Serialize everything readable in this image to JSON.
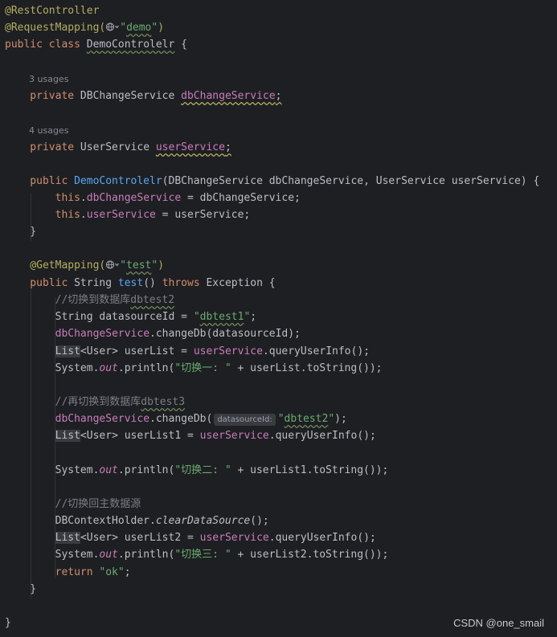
{
  "editor": {
    "lines": [
      [
        {
          "t": "@RestController",
          "c": "ann"
        }
      ],
      [
        {
          "t": "@RequestMapping(",
          "c": "ann"
        },
        {
          "icon": "web-globe-icon"
        },
        {
          "t": "\"",
          "c": "str"
        },
        {
          "t": "demo",
          "c": "str wavy"
        },
        {
          "t": "\"",
          "c": "str"
        },
        {
          "t": ")",
          "c": "ann"
        }
      ],
      [
        {
          "t": "public class ",
          "c": "kw"
        },
        {
          "t": "DemoControlelr",
          "c": "wavy"
        },
        {
          "t": " {",
          "c": ""
        }
      ],
      [],
      [
        {
          "t": "3 usages",
          "c": "usage"
        }
      ],
      [
        {
          "t": "    private ",
          "c": "kw"
        },
        {
          "t": "DBChangeService ",
          "c": ""
        },
        {
          "t": "dbChangeService",
          "c": "fld wavy-warn"
        },
        {
          "t": ";",
          "c": "wavy-warn"
        }
      ],
      [],
      [
        {
          "t": "4 usages",
          "c": "usage"
        }
      ],
      [
        {
          "t": "    private ",
          "c": "kw"
        },
        {
          "t": "UserService ",
          "c": ""
        },
        {
          "t": "userService",
          "c": "fld wavy-warn"
        },
        {
          "t": ";",
          "c": "wavy-warn"
        }
      ],
      [],
      [
        {
          "t": "    public ",
          "c": "kw"
        },
        {
          "t": "DemoControlelr",
          "c": "fn"
        },
        {
          "t": "(DBChangeService dbChangeService, UserService userService) {",
          "c": ""
        }
      ],
      [
        {
          "t": "        this",
          "c": "kw"
        },
        {
          "t": ".",
          "c": ""
        },
        {
          "t": "dbChangeService",
          "c": "fld"
        },
        {
          "t": " = dbChangeService;",
          "c": ""
        }
      ],
      [
        {
          "t": "        this",
          "c": "kw"
        },
        {
          "t": ".",
          "c": ""
        },
        {
          "t": "userService",
          "c": "fld"
        },
        {
          "t": " = userService;",
          "c": ""
        }
      ],
      [
        {
          "t": "    }",
          "c": ""
        }
      ],
      [],
      [
        {
          "t": "    @GetMapping(",
          "c": "ann"
        },
        {
          "icon": "web-globe-icon"
        },
        {
          "t": "\"",
          "c": "str"
        },
        {
          "t": "test",
          "c": "str wavy"
        },
        {
          "t": "\"",
          "c": "str"
        },
        {
          "t": ")",
          "c": "ann"
        }
      ],
      [
        {
          "t": "    public ",
          "c": "kw"
        },
        {
          "t": "String ",
          "c": ""
        },
        {
          "t": "test",
          "c": "fn"
        },
        {
          "t": "() ",
          "c": ""
        },
        {
          "t": "throws ",
          "c": "kw"
        },
        {
          "t": "Exception {",
          "c": ""
        }
      ],
      [
        {
          "t": "        //切换到数据库",
          "c": "cmt"
        },
        {
          "t": "dbtest2",
          "c": "cmt wavy"
        }
      ],
      [
        {
          "t": "        String datasourceId = ",
          "c": ""
        },
        {
          "t": "\"",
          "c": "str"
        },
        {
          "t": "dbtest1",
          "c": "str wavy"
        },
        {
          "t": "\"",
          "c": "str"
        },
        {
          "t": ";",
          "c": ""
        }
      ],
      [
        {
          "t": "        ",
          "c": ""
        },
        {
          "t": "dbChangeService",
          "c": "fld"
        },
        {
          "t": ".changeDb(datasourceId);",
          "c": ""
        }
      ],
      [
        {
          "t": "        ",
          "c": ""
        },
        {
          "t": "List",
          "c": "hl"
        },
        {
          "t": "<User> userList = ",
          "c": ""
        },
        {
          "t": "userService",
          "c": "fld"
        },
        {
          "t": ".queryUserInfo();",
          "c": ""
        }
      ],
      [
        {
          "t": "        System.",
          "c": ""
        },
        {
          "t": "out",
          "c": "fld ital"
        },
        {
          "t": ".println(",
          "c": ""
        },
        {
          "t": "\"切换一: \"",
          "c": "str"
        },
        {
          "t": " + userList.toString());",
          "c": ""
        }
      ],
      [],
      [
        {
          "t": "        //再切换到数据库",
          "c": "cmt"
        },
        {
          "t": "dbtest3",
          "c": "cmt wavy"
        }
      ],
      [
        {
          "t": "        ",
          "c": ""
        },
        {
          "t": "dbChangeService",
          "c": "fld"
        },
        {
          "t": ".changeDb(",
          "c": ""
        },
        {
          "hint": "datasourceId:"
        },
        {
          "t": "\"",
          "c": "str"
        },
        {
          "t": "dbtest2",
          "c": "str wavy"
        },
        {
          "t": "\"",
          "c": "str"
        },
        {
          "t": ");",
          "c": ""
        }
      ],
      [
        {
          "t": "        ",
          "c": ""
        },
        {
          "t": "List",
          "c": "hl"
        },
        {
          "t": "<User> userList1 = ",
          "c": ""
        },
        {
          "t": "userService",
          "c": "fld"
        },
        {
          "t": ".queryUserInfo();",
          "c": ""
        }
      ],
      [],
      [
        {
          "t": "        System.",
          "c": ""
        },
        {
          "t": "out",
          "c": "fld ital"
        },
        {
          "t": ".println(",
          "c": ""
        },
        {
          "t": "\"切换二: \"",
          "c": "str"
        },
        {
          "t": " + userList1.toString());",
          "c": ""
        }
      ],
      [],
      [
        {
          "t": "        //切换回主数据源",
          "c": "cmt"
        }
      ],
      [
        {
          "t": "        DBContextHolder.",
          "c": ""
        },
        {
          "t": "clearDataSource",
          "c": "ital"
        },
        {
          "t": "();",
          "c": ""
        }
      ],
      [
        {
          "t": "        ",
          "c": ""
        },
        {
          "t": "List",
          "c": "hl"
        },
        {
          "t": "<User> userList2 = ",
          "c": ""
        },
        {
          "t": "userService",
          "c": "fld"
        },
        {
          "t": ".queryUserInfo();",
          "c": ""
        }
      ],
      [
        {
          "t": "        System.",
          "c": ""
        },
        {
          "t": "out",
          "c": "fld ital"
        },
        {
          "t": ".println(",
          "c": ""
        },
        {
          "t": "\"切换三: \"",
          "c": "str"
        },
        {
          "t": " + userList2.toString());",
          "c": ""
        }
      ],
      [
        {
          "t": "        return ",
          "c": "kw"
        },
        {
          "t": "\"ok\"",
          "c": "str"
        },
        {
          "t": ";",
          "c": ""
        }
      ],
      [
        {
          "t": "    }",
          "c": ""
        }
      ],
      [],
      [
        {
          "t": "}",
          "c": ""
        }
      ]
    ]
  },
  "watermark": "CSDN @one_smail"
}
